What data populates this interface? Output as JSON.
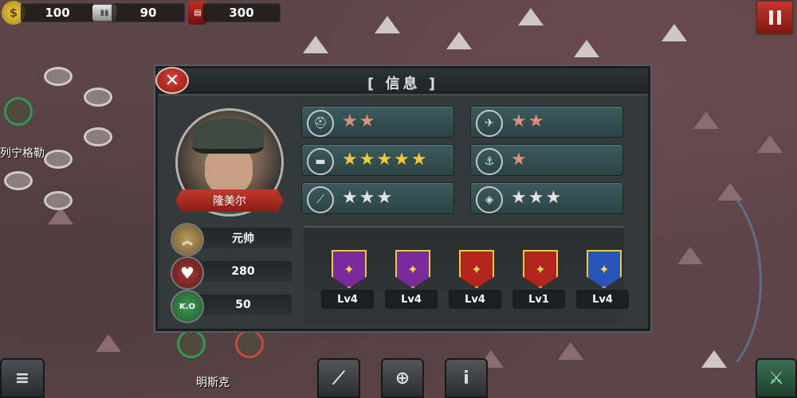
{
  "resources": {
    "gold": "100",
    "steel": "90",
    "oil": "300"
  },
  "map": {
    "city_left": "列宁格勒",
    "city_bottom": "明斯克"
  },
  "info_panel": {
    "title": "[ 信息 ]",
    "general_name": "隆美尔",
    "rank": "元帅",
    "health": "280",
    "kills": "50",
    "kills_badge": "K.O",
    "skills": [
      {
        "icon": "infantry-icon",
        "stars": 2,
        "star_color": "#e08c7b"
      },
      {
        "icon": "aircraft-icon",
        "stars": 2,
        "star_color": "#e08c7b"
      },
      {
        "icon": "tank-icon",
        "stars": 5,
        "star_color": "#f2c838"
      },
      {
        "icon": "navy-icon",
        "stars": 1,
        "star_color": "#e08c7b"
      },
      {
        "icon": "artillery-icon",
        "stars": 3,
        "star_color": "#e3e3e3"
      },
      {
        "icon": "fortress-icon",
        "stars": 3,
        "star_color": "#e3e3e3"
      }
    ],
    "medals": [
      {
        "label": "Lv4",
        "color": "#7a2a9a"
      },
      {
        "label": "Lv4",
        "color": "#7a2a9a"
      },
      {
        "label": "Lv4",
        "color": "#b3241c"
      },
      {
        "label": "Lv1",
        "color": "#b3241c"
      },
      {
        "label": "Lv4",
        "color": "#2a55b8"
      }
    ]
  },
  "bottom_bar": {
    "info_glyph": "i"
  }
}
